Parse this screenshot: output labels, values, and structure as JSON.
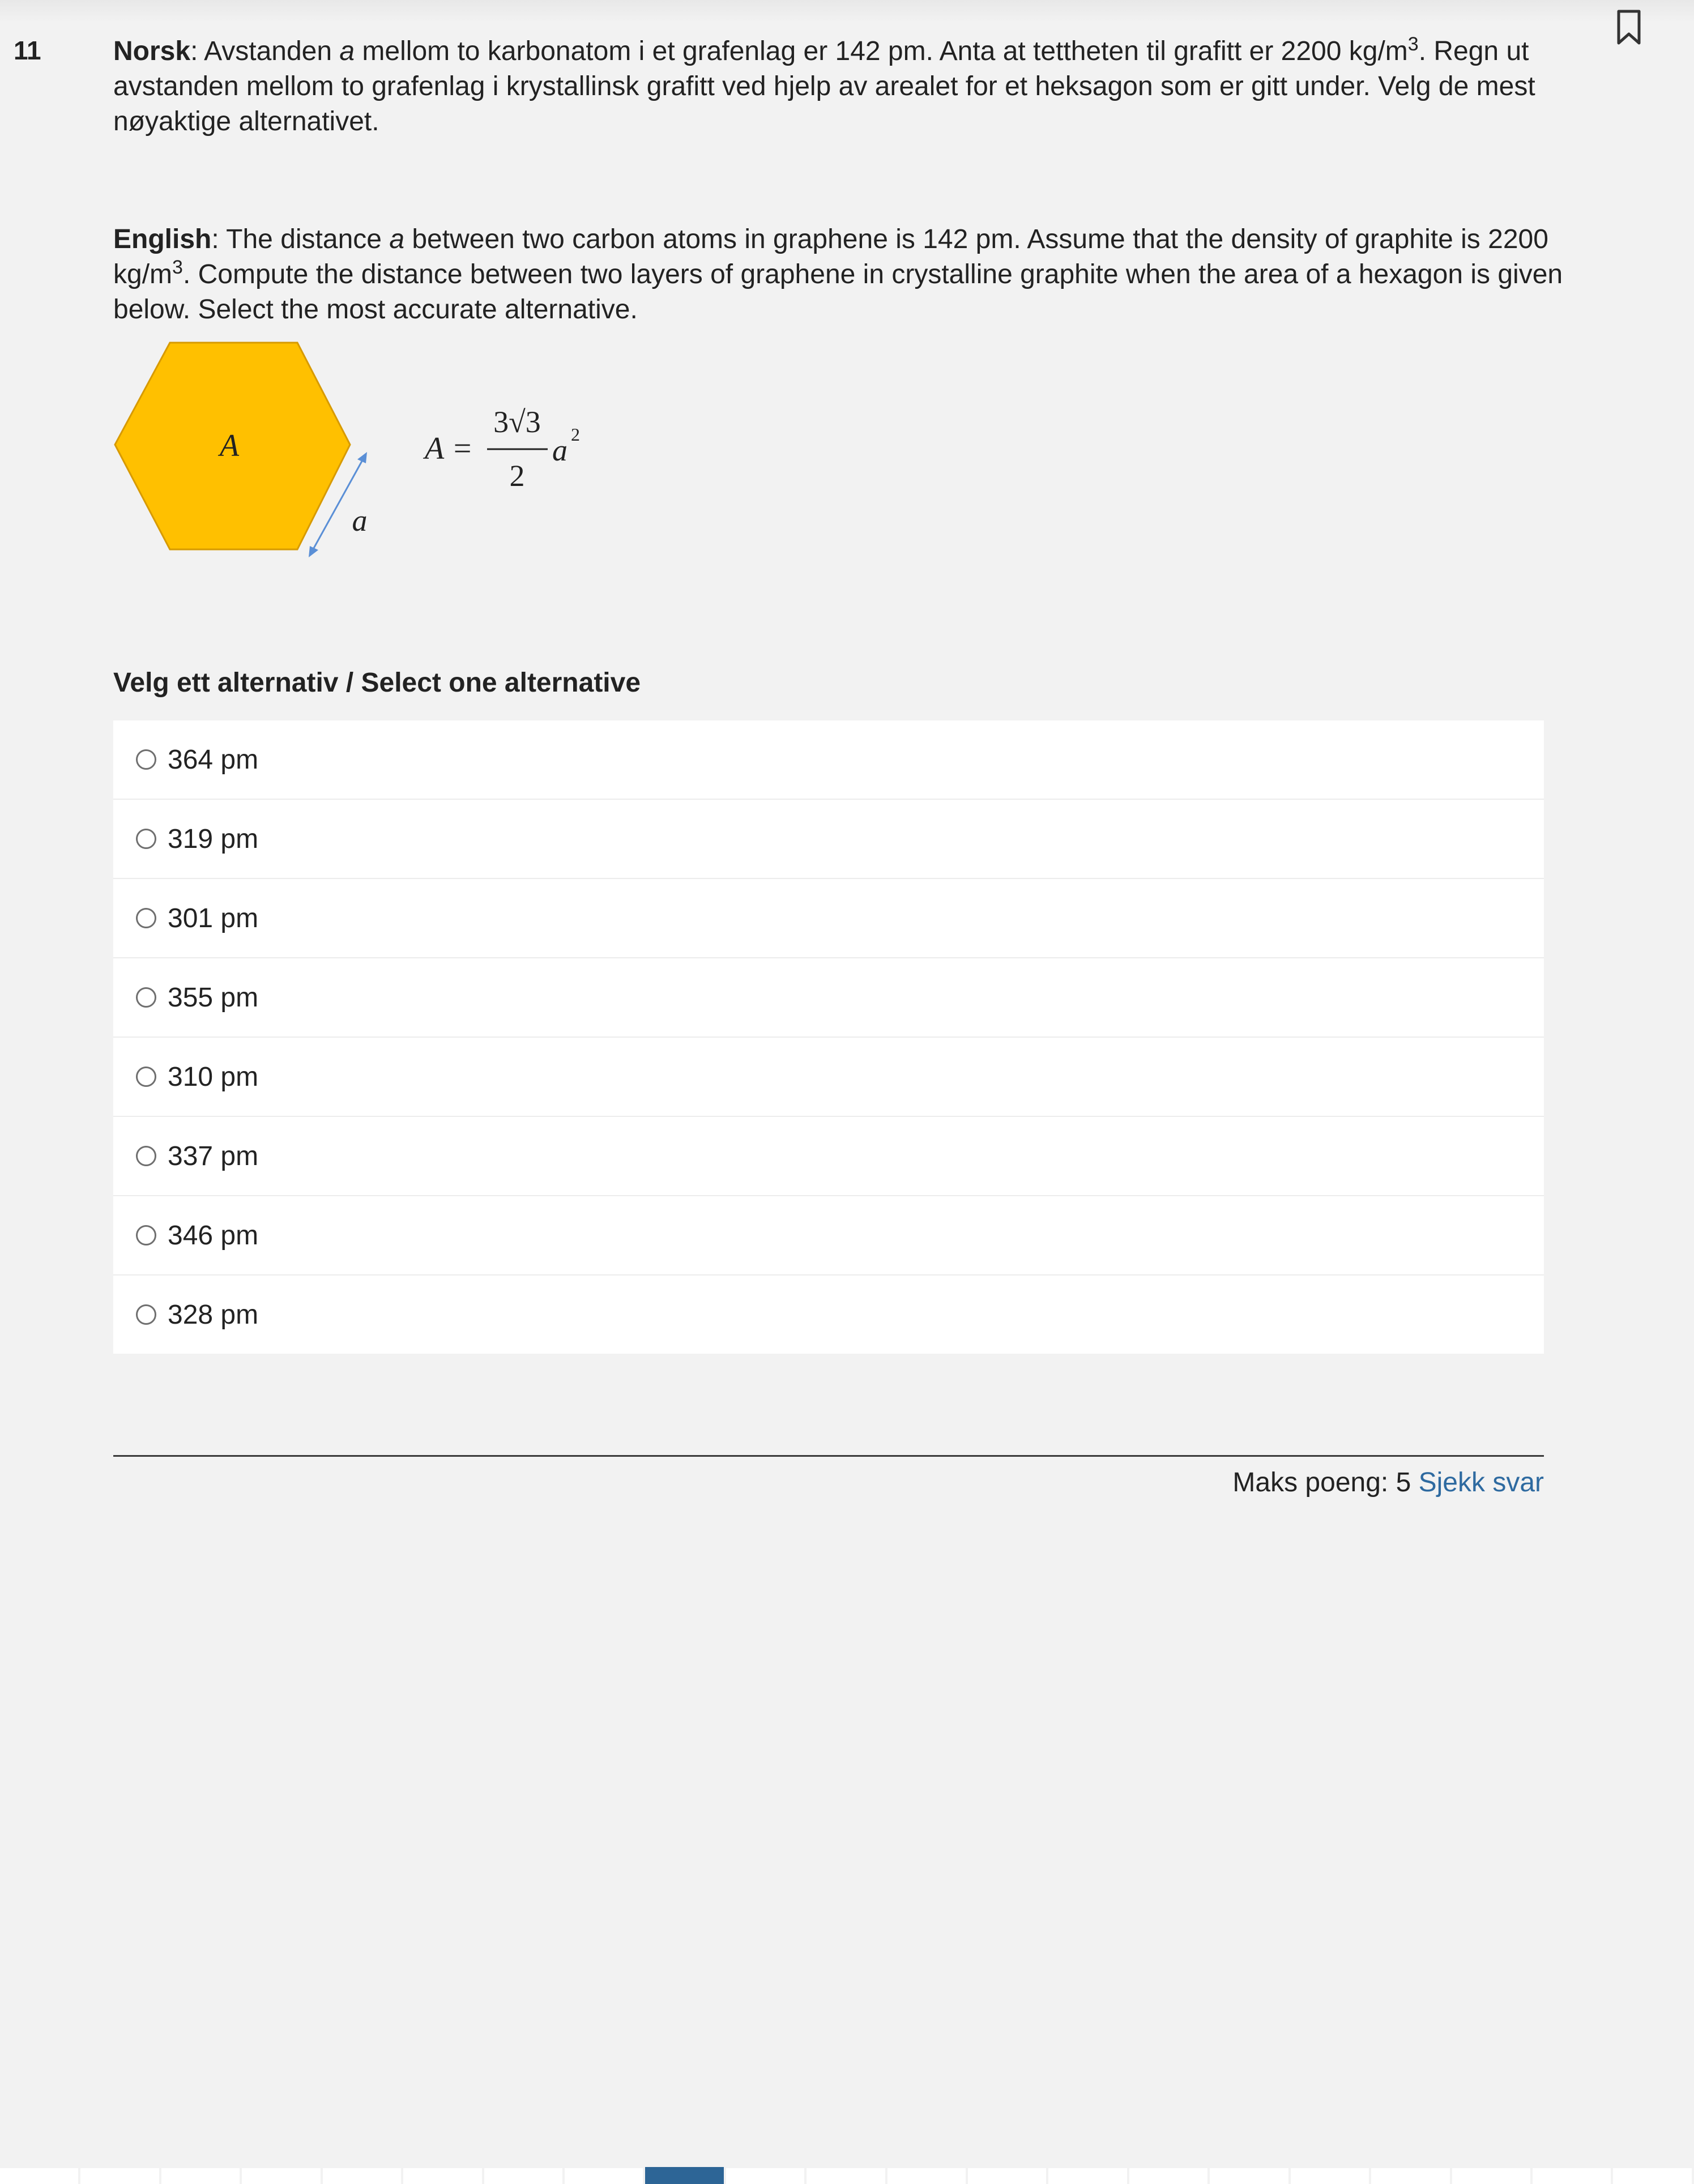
{
  "question": {
    "number": "11",
    "norsk_label": "Norsk",
    "norsk_text_1": ": Avstanden ",
    "norsk_var": "a",
    "norsk_text_2": " mellom to karbonatom i et grafenlag er 142 pm. Anta at tettheten til grafitt er 2200 kg/m",
    "norsk_sup": "3",
    "norsk_text_3": ". Regn ut avstanden mellom to grafenlag i krystallinsk grafitt ved hjelp av arealet for et heksagon som er gitt under. Velg de mest nøyaktige alternativet.",
    "english_label": "English",
    "english_text_1": ": The distance ",
    "english_var": "a",
    "english_text_2": " between two carbon atoms in graphene is 142 pm. Assume that the density of graphite is 2200 kg/m",
    "english_sup": "3",
    "english_text_3": ". Compute the distance between two layers of graphene in crystalline graphite when the area of a hexagon is given below. Select the most accurate alternative."
  },
  "figure": {
    "hexagon_label": "A",
    "side_label": "a",
    "formula_lhs": "A =",
    "formula_num": "3√3",
    "formula_den": "2",
    "formula_var": "a",
    "formula_exp": "2",
    "hexagon_color": "#ffc000",
    "arrow_color": "#5a8fd6"
  },
  "select_label": "Velg ett alternativ / Select one alternative",
  "options": [
    "364 pm",
    "319 pm",
    "301 pm",
    "355 pm",
    "310 pm",
    "337 pm",
    "346 pm",
    "328 pm"
  ],
  "footer": {
    "max_points_label": "Maks poeng: 5",
    "check_answer": "Sjekk svar"
  },
  "icons": {
    "bookmark": "bookmark-icon"
  }
}
